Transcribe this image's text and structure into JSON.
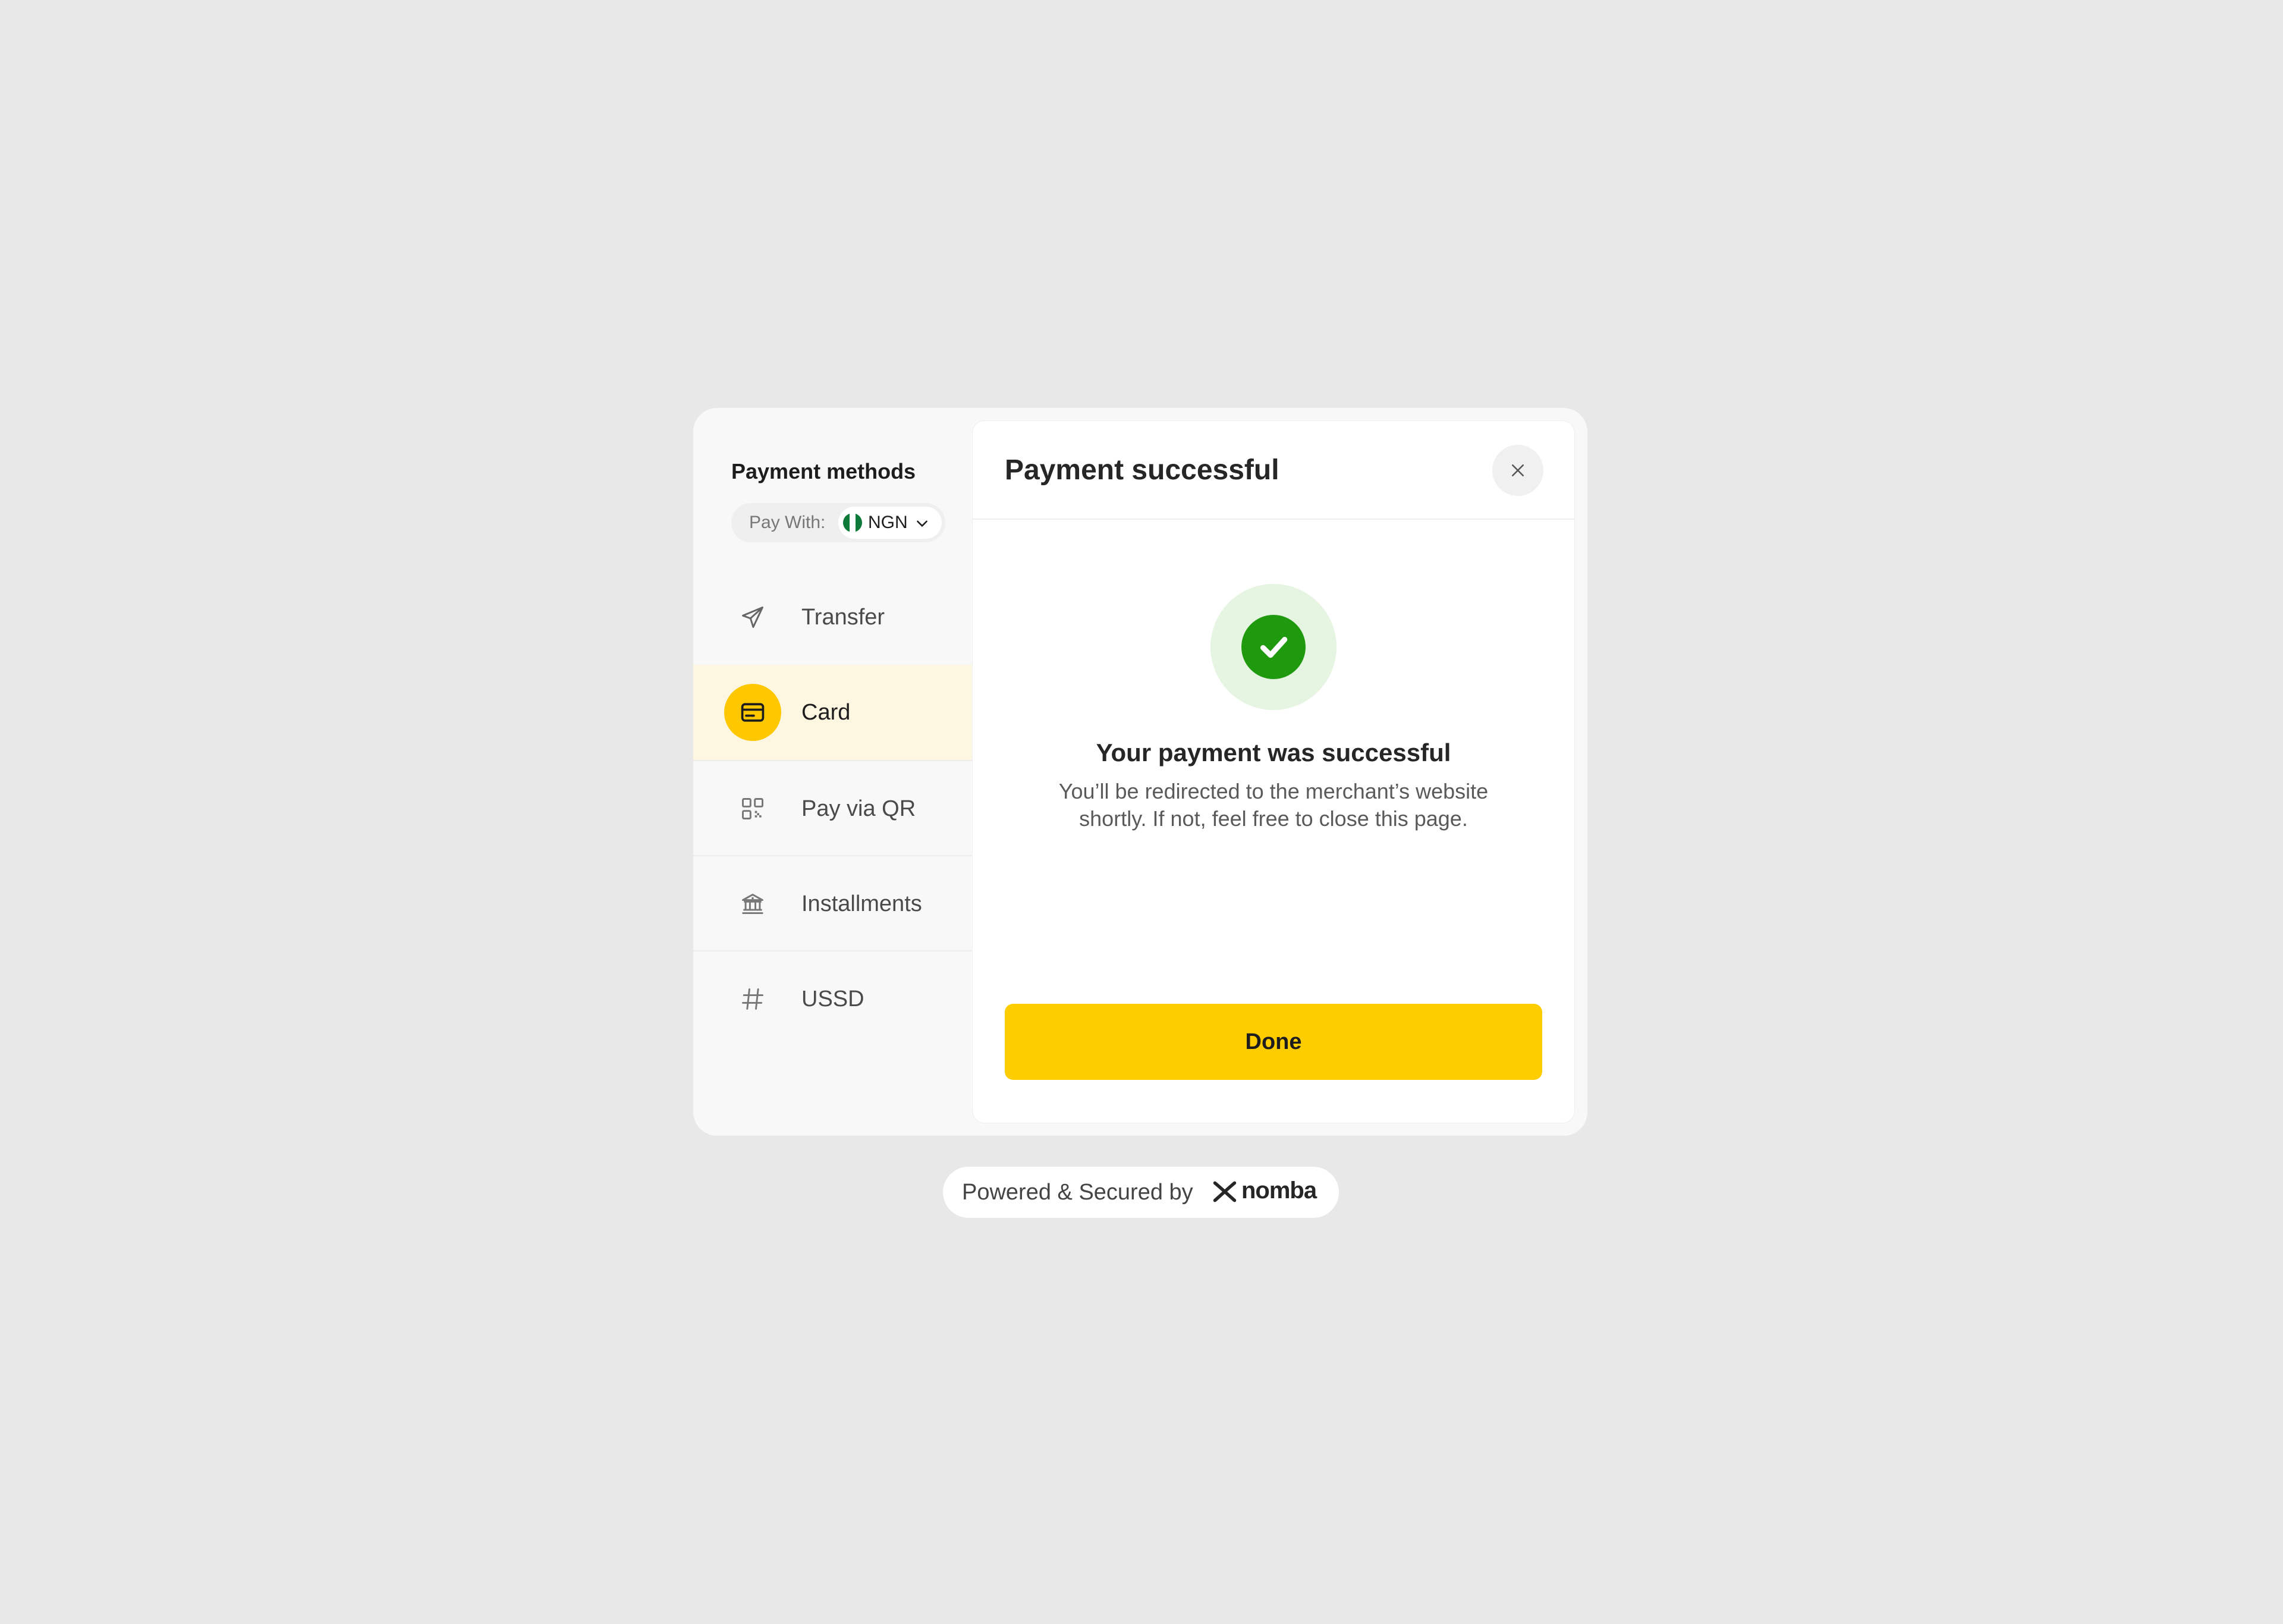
{
  "sidebar": {
    "title": "Payment methods",
    "pay_with_label": "Pay With:",
    "currency": "NGN",
    "methods": [
      {
        "label": "Transfer",
        "icon": "send-icon"
      },
      {
        "label": "Card",
        "icon": "card-icon",
        "active": true
      },
      {
        "label": "Pay via QR",
        "icon": "qr-code-icon"
      },
      {
        "label": "Installments",
        "icon": "bank-icon"
      },
      {
        "label": "USSD",
        "icon": "hash-icon"
      }
    ]
  },
  "panel": {
    "title": "Payment successful",
    "success_heading": "Your payment was successful",
    "success_body": "You’ll be redirected to the merchant’s website shortly. If not, feel free to close this page.",
    "done_label": "Done"
  },
  "footer": {
    "powered_text": "Powered & Secured by",
    "brand": "nomba"
  },
  "colors": {
    "accent": "#fecd00",
    "success": "#1f9a0f",
    "active_row": "#fdf6e0",
    "background": "#e8e8e8"
  }
}
